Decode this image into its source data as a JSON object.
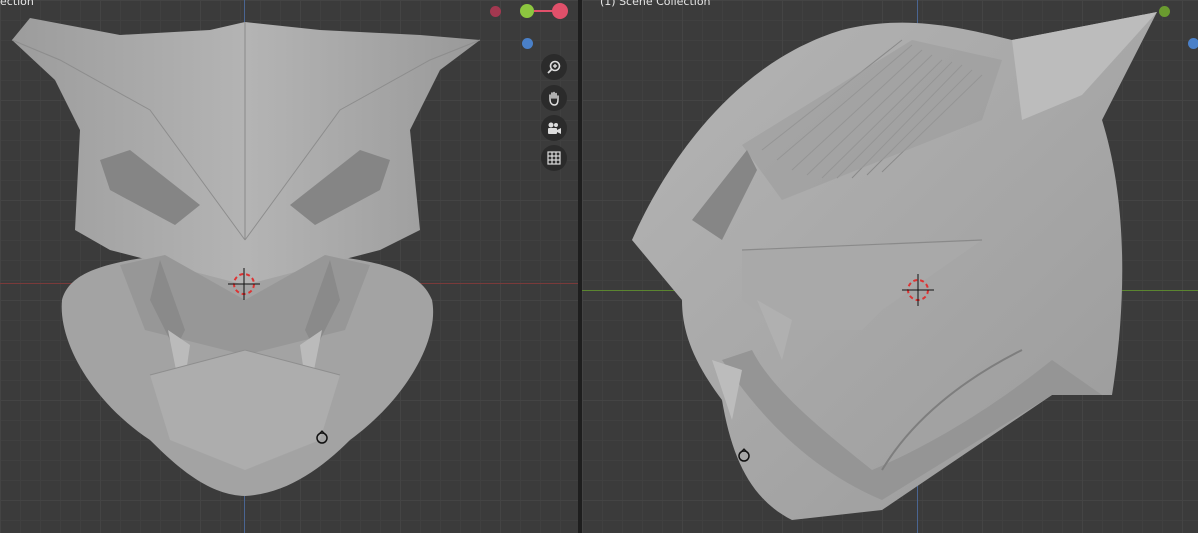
{
  "left_viewport": {
    "collection_label": "ection",
    "nav_buttons": [
      {
        "name": "zoom-icon"
      },
      {
        "name": "pan-hand-icon"
      },
      {
        "name": "camera-icon"
      },
      {
        "name": "ortho-grid-icon"
      }
    ],
    "axis_colors": {
      "x": "#e0506a",
      "y": "#8cc63f",
      "z": "#4a80c8"
    }
  },
  "right_viewport": {
    "collection_label": "(1) Scene Collection"
  },
  "colors": {
    "background": "#3b3b3b",
    "grid": "#444444",
    "x_axis_line": "#8a3b3b",
    "y_axis_line": "#5e8a2f",
    "z_axis_line": "#4c6a9a",
    "mesh": "#a8a8a8",
    "divider": "#1e1e1e"
  }
}
